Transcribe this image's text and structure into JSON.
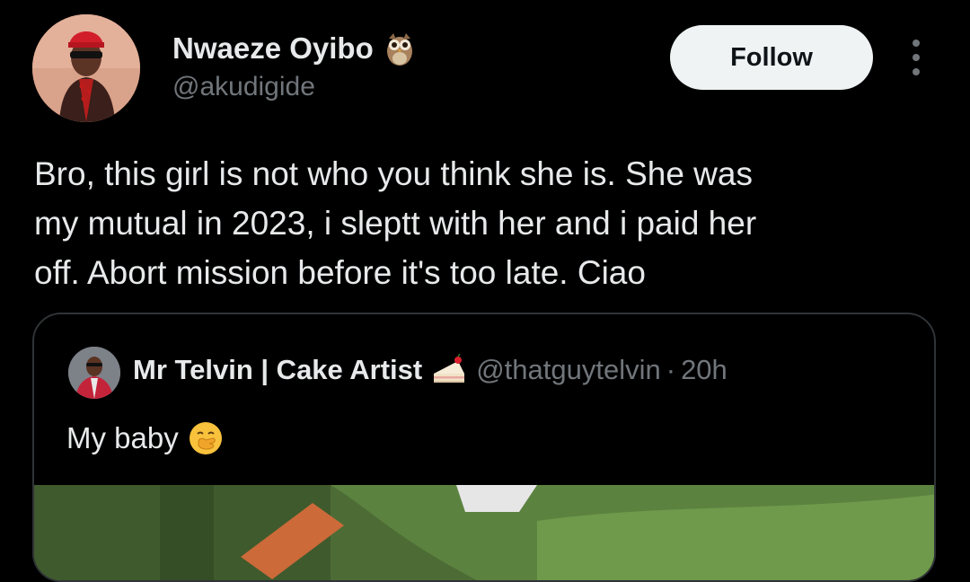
{
  "post": {
    "author": {
      "display_name": "Nwaeze Oyibo",
      "handle": "@akudigide",
      "badge_icon": "owl-icon"
    },
    "follow_label": "Follow",
    "text_lines": [
      "Bro, this girl is not who you think she is. She was",
      "my mutual in 2023, i sleptt with her and i paid her",
      "off. Abort mission before it's too late. Ciao"
    ]
  },
  "quote": {
    "display_name": "Mr Telvin | Cake Artist",
    "badge_icon": "cake-slice-icon",
    "handle": "@thatguytelvin",
    "separator": "·",
    "time": "20h",
    "text": "My baby",
    "emoji": "face-with-hand-over-mouth-icon"
  },
  "colors": {
    "background": "#000000",
    "text_primary": "#e7e9ea",
    "text_secondary": "#71767b",
    "border": "#2f3336",
    "follow_bg": "#eff3f4"
  }
}
